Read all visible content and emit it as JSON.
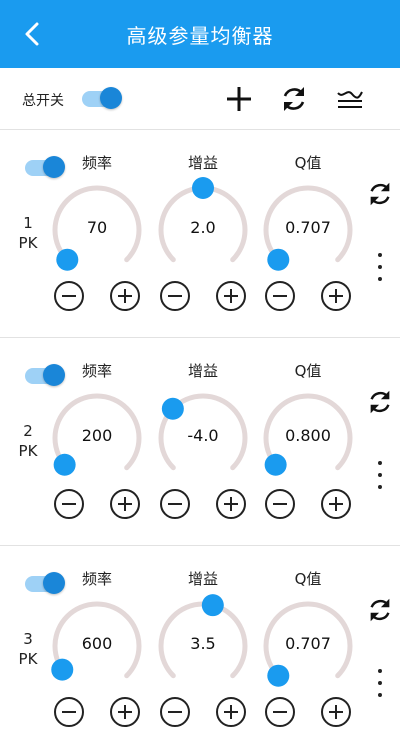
{
  "header": {
    "title": "高级参量均衡器",
    "back_icon": "chevron-left-icon"
  },
  "toolbar": {
    "master_label": "总开关",
    "master_on": true,
    "icons": [
      "plus-icon",
      "refresh-icon",
      "curve-icon"
    ]
  },
  "column_labels": {
    "freq": "频率",
    "gain": "增益",
    "q": "Q值"
  },
  "colors": {
    "accent": "#1a9bef",
    "knob_track": "#e3d8d8",
    "toggle_track": "#9ed1f6"
  },
  "bands": [
    {
      "index": "1",
      "type": "PK",
      "enabled": true,
      "freq": "70",
      "gain": "2.0",
      "q": "0.707",
      "freq_level": 0.0,
      "gain_level": 0.5,
      "q_level": 0.0
    },
    {
      "index": "2",
      "type": "PK",
      "enabled": true,
      "freq": "200",
      "gain": "-4.0",
      "q": "0.800",
      "freq_level": 0.02,
      "gain_level": 0.33,
      "q_level": 0.02
    },
    {
      "index": "3",
      "type": "PK",
      "enabled": true,
      "freq": "600",
      "gain": "3.5",
      "q": "0.707",
      "freq_level": 0.04,
      "gain_level": 0.55,
      "q_level": 0.0
    }
  ]
}
